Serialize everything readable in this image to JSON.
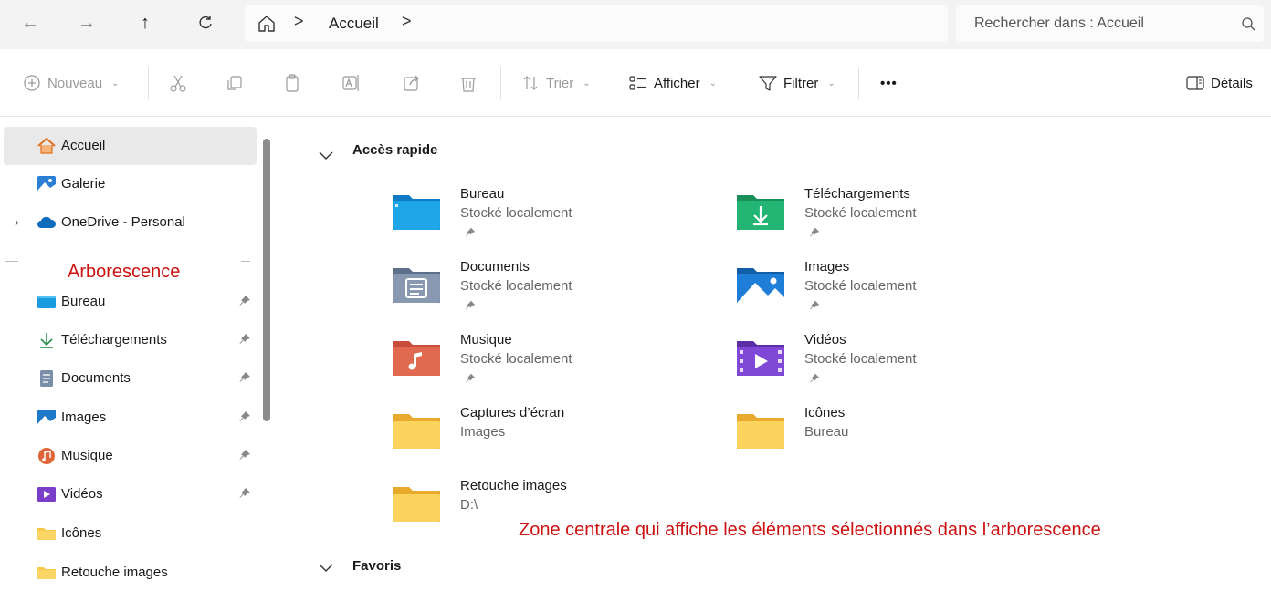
{
  "address": {
    "crumb_sep": ">",
    "location": "Accueil",
    "crumb_trail_sep": ">",
    "search_placeholder": "Rechercher dans : Accueil"
  },
  "toolbar": {
    "new_label": "Nouveau",
    "sort_label": "Trier",
    "view_label": "Afficher",
    "filter_label": "Filtrer",
    "more_label": "•••",
    "details_label": "Détails"
  },
  "sidebar": {
    "items": [
      {
        "label": "Accueil",
        "icon": "home-icon"
      },
      {
        "label": "Galerie",
        "icon": "gallery-icon"
      },
      {
        "label": "OneDrive - Personal",
        "icon": "cloud-icon"
      }
    ],
    "annotation": "Arborescence",
    "pinned": [
      {
        "label": "Bureau",
        "icon": "desktop-folder-icon",
        "pinned": true
      },
      {
        "label": "Téléchargements",
        "icon": "download-icon",
        "pinned": true
      },
      {
        "label": "Documents",
        "icon": "documents-icon",
        "pinned": true
      },
      {
        "label": "Images",
        "icon": "images-icon",
        "pinned": true
      },
      {
        "label": "Musique",
        "icon": "music-icon",
        "pinned": true
      },
      {
        "label": "Vidéos",
        "icon": "videos-icon",
        "pinned": true
      },
      {
        "label": "Icônes",
        "icon": "folder-icon",
        "pinned": false
      },
      {
        "label": "Retouche images",
        "icon": "folder-icon",
        "pinned": false
      }
    ]
  },
  "main": {
    "quick_access_title": "Accès rapide",
    "favorites_title": "Favoris",
    "annotation": "Zone centrale qui affiche les éléments sélectionnés dans l’arborescence",
    "tiles": [
      {
        "name": "Bureau",
        "sub": "Stocké localement",
        "pinned": true,
        "icon": "desktop-folder-icon"
      },
      {
        "name": "Téléchargements",
        "sub": "Stocké localement",
        "pinned": true,
        "icon": "download-folder-icon"
      },
      {
        "name": "Documents",
        "sub": "Stocké localement",
        "pinned": true,
        "icon": "documents-folder-icon"
      },
      {
        "name": "Images",
        "sub": "Stocké localement",
        "pinned": true,
        "icon": "images-folder-icon"
      },
      {
        "name": "Musique",
        "sub": "Stocké localement",
        "pinned": true,
        "icon": "music-folder-icon"
      },
      {
        "name": "Vidéos",
        "sub": "Stocké localement",
        "pinned": true,
        "icon": "videos-folder-icon"
      },
      {
        "name": "Captures d’écran",
        "sub": "Images",
        "pinned": false,
        "icon": "folder-icon"
      },
      {
        "name": "Icônes",
        "sub": "Bureau",
        "pinned": false,
        "icon": "folder-icon"
      },
      {
        "name": "Retouche images",
        "sub": "D:\\",
        "pinned": false,
        "icon": "folder-icon"
      }
    ]
  },
  "colors": {
    "annotation_red": "#cc1111",
    "selected_bg": "#e9e9e9",
    "folder_yellow": "#f8c84a"
  }
}
